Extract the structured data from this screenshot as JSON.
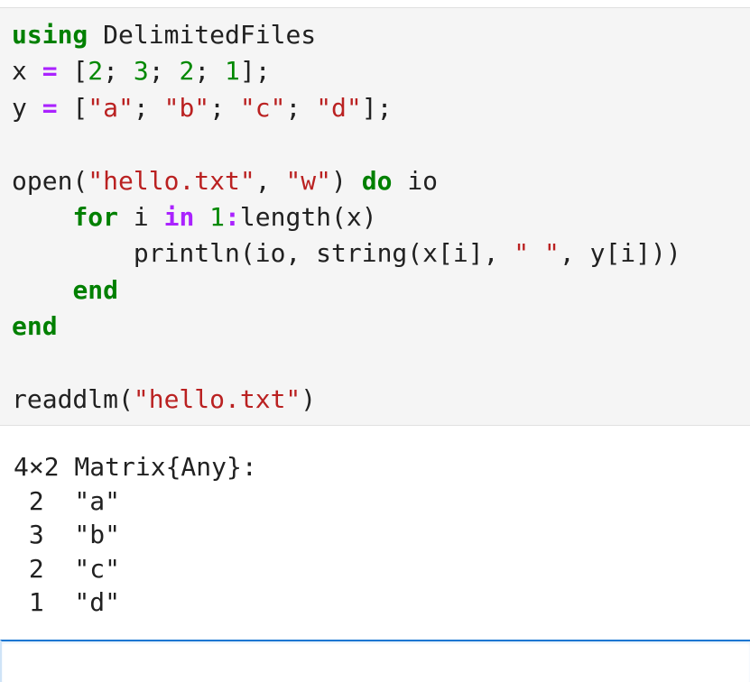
{
  "input_cell": {
    "lines": [
      [
        {
          "t": "using",
          "c": "kw"
        },
        {
          "t": " DelimitedFiles",
          "c": ""
        }
      ],
      [
        {
          "t": "x ",
          "c": ""
        },
        {
          "t": "=",
          "c": "op"
        },
        {
          "t": " [",
          "c": ""
        },
        {
          "t": "2",
          "c": "num"
        },
        {
          "t": "; ",
          "c": ""
        },
        {
          "t": "3",
          "c": "num"
        },
        {
          "t": "; ",
          "c": ""
        },
        {
          "t": "2",
          "c": "num"
        },
        {
          "t": "; ",
          "c": ""
        },
        {
          "t": "1",
          "c": "num"
        },
        {
          "t": "];",
          "c": ""
        }
      ],
      [
        {
          "t": "y ",
          "c": ""
        },
        {
          "t": "=",
          "c": "op"
        },
        {
          "t": " [",
          "c": ""
        },
        {
          "t": "\"a\"",
          "c": "str"
        },
        {
          "t": "; ",
          "c": ""
        },
        {
          "t": "\"b\"",
          "c": "str"
        },
        {
          "t": "; ",
          "c": ""
        },
        {
          "t": "\"c\"",
          "c": "str"
        },
        {
          "t": "; ",
          "c": ""
        },
        {
          "t": "\"d\"",
          "c": "str"
        },
        {
          "t": "];",
          "c": ""
        }
      ],
      [],
      [
        {
          "t": "open(",
          "c": ""
        },
        {
          "t": "\"hello.txt\"",
          "c": "str"
        },
        {
          "t": ", ",
          "c": ""
        },
        {
          "t": "\"w\"",
          "c": "str"
        },
        {
          "t": ") ",
          "c": ""
        },
        {
          "t": "do",
          "c": "kw"
        },
        {
          "t": " io",
          "c": ""
        }
      ],
      [
        {
          "t": "    ",
          "c": ""
        },
        {
          "t": "for",
          "c": "kw"
        },
        {
          "t": " i ",
          "c": ""
        },
        {
          "t": "in",
          "c": "op"
        },
        {
          "t": " ",
          "c": ""
        },
        {
          "t": "1",
          "c": "num"
        },
        {
          "t": ":",
          "c": "op"
        },
        {
          "t": "length(x)",
          "c": ""
        }
      ],
      [
        {
          "t": "        println(io, string(x[i], ",
          "c": ""
        },
        {
          "t": "\" \"",
          "c": "str"
        },
        {
          "t": ", y[i]))",
          "c": ""
        }
      ],
      [
        {
          "t": "    ",
          "c": ""
        },
        {
          "t": "end",
          "c": "kw"
        }
      ],
      [
        {
          "t": "end",
          "c": "kw"
        }
      ],
      [],
      [
        {
          "t": "readdlm(",
          "c": ""
        },
        {
          "t": "\"hello.txt\"",
          "c": "str"
        },
        {
          "t": ")",
          "c": ""
        }
      ]
    ]
  },
  "output_cell": {
    "lines": [
      "4×2 Matrix{Any}:",
      " 2  \"a\"",
      " 3  \"b\"",
      " 2  \"c\"",
      " 1  \"d\""
    ]
  }
}
